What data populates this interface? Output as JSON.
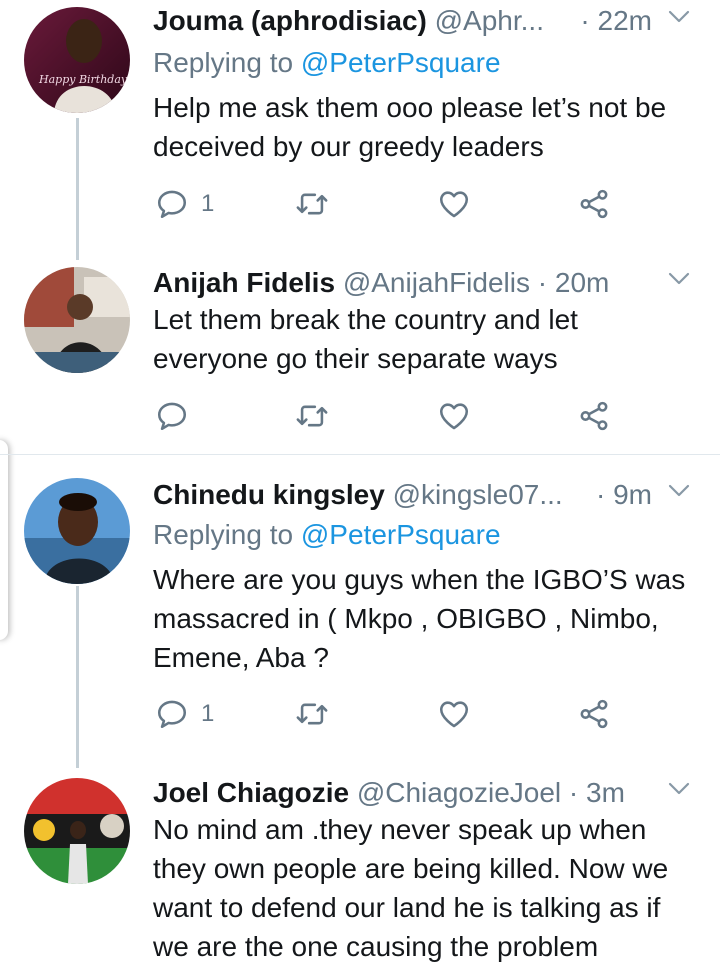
{
  "tweets": [
    {
      "name": "Jouma (aphrodisiac)",
      "handle": "@Aphr...",
      "time": "· 22m",
      "replying_prefix": "Replying to",
      "replying_to": "@PeterPsquare",
      "text": "Help me ask them ooo please let’s not be deceived by our greedy leaders",
      "reply_count": "1",
      "avatar_text": "Happy Birthday"
    },
    {
      "name": "Anijah Fidelis",
      "handle": "@AnijahFidelis",
      "time": "· 20m",
      "text": "Let them break the country and let everyone go their separate ways",
      "reply_count": ""
    },
    {
      "name": "Chinedu kingsley",
      "handle": "@kingsle07...",
      "time": "· 9m",
      "replying_prefix": "Replying to",
      "replying_to": "@PeterPsquare",
      "text": "Where are you guys when the IGBO’S was massacred in ( Mkpo , OBIGBO , Nimbo, Emene, Aba  ?",
      "reply_count": "1"
    },
    {
      "name": "Joel Chiagozie",
      "handle": "@ChiagozieJoel",
      "time": "· 3m",
      "text": "No mind am .they never speak up when they own people are being killed. Now we want to defend our land he is talking as if we are the one causing the problem",
      "reply_count": ""
    }
  ],
  "icons": {
    "reply": "reply-icon",
    "retweet": "retweet-icon",
    "like": "heart-icon",
    "share": "share-icon",
    "menu": "chevron-down-icon"
  },
  "colors": {
    "name": "#14171a",
    "secondary": "#657786",
    "link": "#1b95e0",
    "thread_line": "#c4cfd6",
    "divider": "#e1e8ed"
  }
}
